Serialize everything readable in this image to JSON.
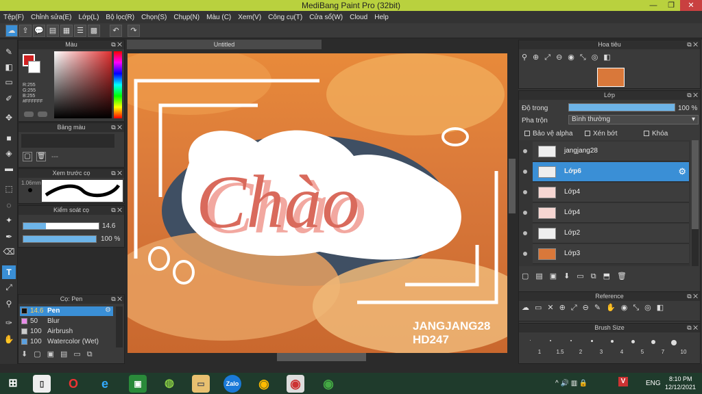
{
  "window": {
    "title": "MediBang Paint Pro (32bit)"
  },
  "menu": [
    "Tệp(F)",
    "Chỉnh sửa(E)",
    "Lớp(L)",
    "Bộ lọc(R)",
    "Chọn(S)",
    "Chụp(N)",
    "Màu (C)",
    "Xem(V)",
    "Công cụ(T)",
    "Cửa sổ(W)",
    "Cloud",
    "Help"
  ],
  "color_panel": {
    "title": "Màu",
    "r": "R:255",
    "g": "G:255",
    "b": "B:255",
    "hex": "#FFFFFF"
  },
  "palette_panel": {
    "title": "Bảng màu",
    "dash": "---"
  },
  "brush_preview": {
    "title": "Xem trước cọ",
    "size": "1.06mm"
  },
  "brush_control": {
    "title": "Kiểm soát cọ",
    "size_value": "14.6",
    "opacity_value": "100 %"
  },
  "brush_panel": {
    "title": "Cọ: Pen",
    "items": [
      {
        "size": "14.6",
        "name": "Pen",
        "color": "#111111"
      },
      {
        "size": "50",
        "name": "Blur",
        "color": "#e88ce8"
      },
      {
        "size": "100",
        "name": "Airbrush",
        "color": "#cccccc"
      },
      {
        "size": "100",
        "name": "Watercolor (Wet)",
        "color": "#5aa0e0"
      }
    ]
  },
  "canvas": {
    "tab": "Untitled",
    "watermark_line1": "JANGJANG28",
    "watermark_line2": "HD247",
    "artwork_text": "Chào"
  },
  "navigator": {
    "title": "Hoa tiêu"
  },
  "layer_panel": {
    "title": "Lớp",
    "opacity_label": "Độ trong",
    "opacity_value": "100 %",
    "opacity_fraction": 1.0,
    "blend_label": "Pha trộn",
    "blend_value": "Bình thường",
    "protect_alpha": "Bảo vệ alpha",
    "clip": "Xén bớt",
    "lock": "Khóa",
    "layers": [
      "jangjang28",
      "Lớp6",
      "Lớp4",
      "Lớp4",
      "Lớp2",
      "Lớp3"
    ],
    "selected_index": 1
  },
  "reference_panel": {
    "title": "Reference"
  },
  "brush_size_panel": {
    "title": "Brush Size",
    "sizes": [
      "1",
      "1.5",
      "2",
      "3",
      "4",
      "5",
      "7",
      "10"
    ]
  },
  "taskbar": {
    "lang": "ENG",
    "time": "8:10 PM",
    "date": "12/12/2021",
    "zalo": "Zalo"
  },
  "colors": {
    "titlebar": "#b9d13e",
    "selection": "#3a8fd6",
    "accent_bar": "#6db4e8"
  }
}
